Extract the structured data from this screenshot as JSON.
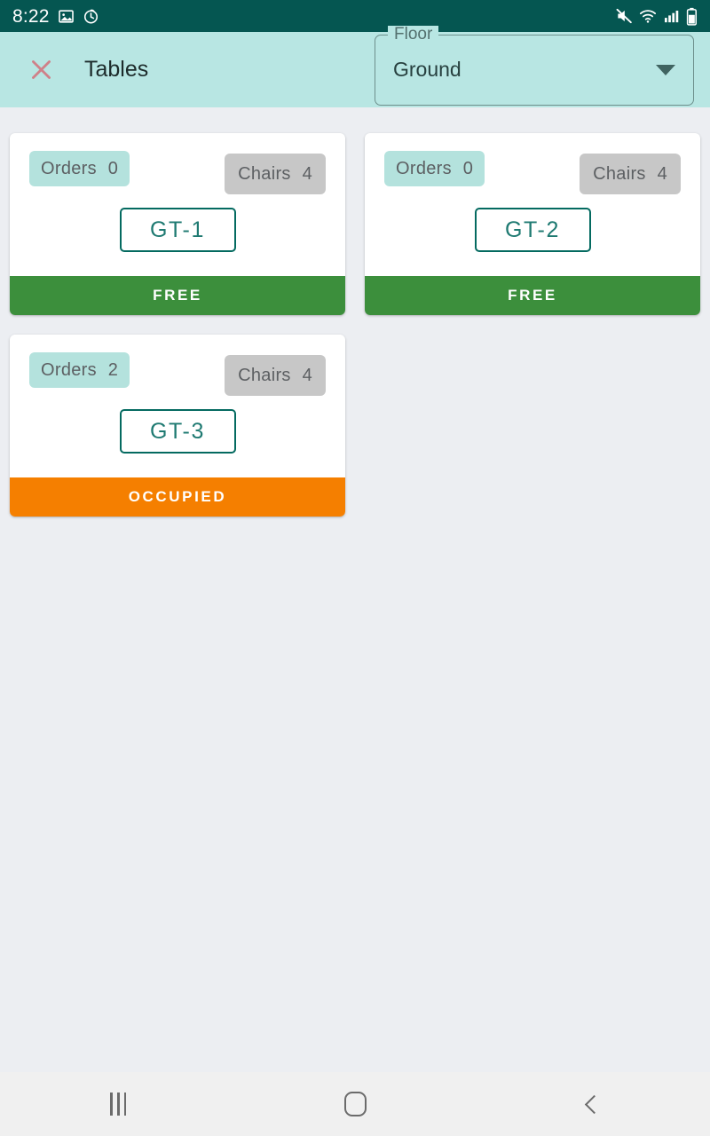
{
  "status_bar": {
    "time": "8:22",
    "left_icons": [
      "image-icon",
      "alarm-icon"
    ],
    "right_icons": [
      "mute-icon",
      "wifi-icon",
      "cellular-signal-icon",
      "battery-icon"
    ],
    "background_color": "#055651"
  },
  "app_bar": {
    "close_label": "close-icon",
    "title": "Tables",
    "background_color": "#b8e6e3",
    "floor_select": {
      "label": "Floor",
      "value": "Ground",
      "options": [
        "Ground"
      ]
    }
  },
  "tables": [
    {
      "orders_label": "Orders",
      "orders_count": "0",
      "chairs_label": "Chairs",
      "chairs_count": "4",
      "code": "GT-1",
      "status": "FREE",
      "status_color": "#3c8f3c"
    },
    {
      "orders_label": "Orders",
      "orders_count": "0",
      "chairs_label": "Chairs",
      "chairs_count": "4",
      "code": "GT-2",
      "status": "FREE",
      "status_color": "#3c8f3c"
    },
    {
      "orders_label": "Orders",
      "orders_count": "2",
      "chairs_label": "Chairs",
      "chairs_count": "4",
      "code": "GT-3",
      "status": "OCCUPIED",
      "status_color": "#f57f00"
    }
  ],
  "nav_bar": {
    "recents": "recents-icon",
    "home": "home-icon",
    "back": "back-icon"
  }
}
